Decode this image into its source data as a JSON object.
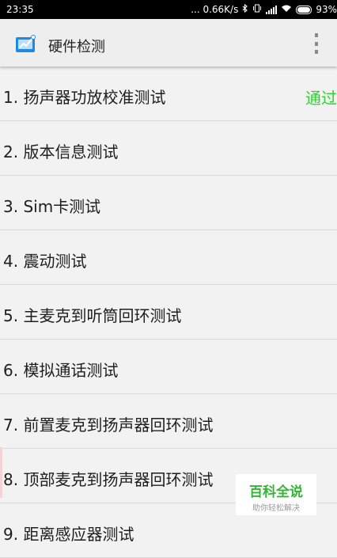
{
  "status_bar": {
    "time": "23:35",
    "speed": "... 0.66K/s",
    "icons": [
      "bluetooth-icon",
      "vibrate-icon",
      "signal-icon",
      "wifi-icon",
      "battery-icon"
    ],
    "battery": "93%"
  },
  "app_bar": {
    "title": "硬件检测",
    "icon": "app-icon",
    "menu_icon": "overflow-menu-icon"
  },
  "tests": [
    {
      "label": "1. 扬声器功放校准测试",
      "result": "通过"
    },
    {
      "label": "2. 版本信息测试",
      "result": ""
    },
    {
      "label": "3. Sim卡测试",
      "result": ""
    },
    {
      "label": "4. 震动测试",
      "result": ""
    },
    {
      "label": "5. 主麦克到听筒回环测试",
      "result": ""
    },
    {
      "label": "6. 模拟通话测试",
      "result": ""
    },
    {
      "label": "7. 前置麦克到扬声器回环测试",
      "result": ""
    },
    {
      "label": "8. 顶部麦克到扬声器回环测试",
      "result": ""
    },
    {
      "label": "9. 距离感应器测试",
      "result": ""
    }
  ],
  "watermark": {
    "title": "百科全说",
    "subtitle": "助你轻松解决"
  },
  "colors": {
    "pass": "#2bd32b",
    "app_bar_bg": "#eeeeee",
    "list_bg": "#f2f2f2"
  }
}
